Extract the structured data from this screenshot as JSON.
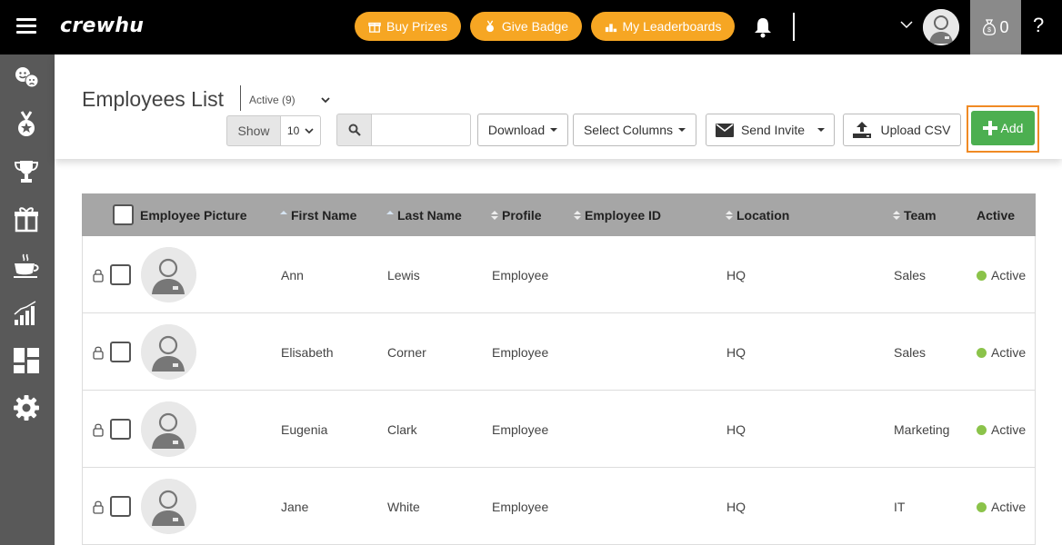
{
  "brand": {
    "logo": "crewhu"
  },
  "header": {
    "buy_prizes": "Buy Prizes",
    "give_badge": "Give Badge",
    "my_leaderboards": "My Leaderboards",
    "coins": "0",
    "help": "?",
    "accent_color": "#f6a623"
  },
  "sidebar": {
    "icons": [
      "mood-icon",
      "badge-medal-icon",
      "trophy-icon",
      "gift-icon",
      "coffee-icon",
      "analytics-chart-icon",
      "dashboard-icon",
      "settings-gear-icon"
    ]
  },
  "page": {
    "title": "Employees List",
    "status_filter": "Active (9)"
  },
  "toolbar": {
    "show_label": "Show",
    "show_value": "10",
    "download": "Download",
    "select_columns": "Select Columns",
    "send_invite": "Send Invite",
    "upload_csv": "Upload CSV",
    "add": "Add",
    "add_color": "#4caf50"
  },
  "table": {
    "columns": [
      "Employee Picture",
      "First Name",
      "Last Name",
      "Profile",
      "Employee ID",
      "Location",
      "Team",
      "Active"
    ],
    "rows": [
      {
        "first": "Ann",
        "last": "Lewis",
        "profile": "Employee",
        "employee_id": "",
        "location": "HQ",
        "team": "Sales",
        "active": "Active"
      },
      {
        "first": "Elisabeth",
        "last": "Corner",
        "profile": "Employee",
        "employee_id": "",
        "location": "HQ",
        "team": "Sales",
        "active": "Active"
      },
      {
        "first": "Eugenia",
        "last": "Clark",
        "profile": "Employee",
        "employee_id": "",
        "location": "HQ",
        "team": "Marketing",
        "active": "Active"
      },
      {
        "first": "Jane",
        "last": "White",
        "profile": "Employee",
        "employee_id": "",
        "location": "HQ",
        "team": "IT",
        "active": "Active"
      }
    ]
  }
}
